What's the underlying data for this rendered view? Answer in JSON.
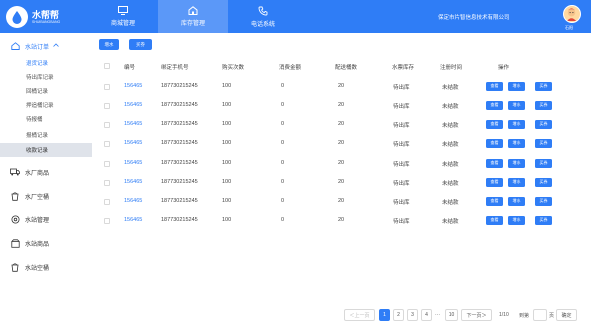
{
  "header": {
    "logo_name": "水帮帮",
    "logo_sub": "SHUIBANGBANG",
    "tabs": [
      {
        "label": "商城管理"
      },
      {
        "label": "库存管理"
      },
      {
        "label": "电话系统"
      }
    ],
    "company": "保定市片智信息技术有限公司",
    "username": "石阳"
  },
  "sidebar": {
    "groups": [
      {
        "label": "水站订单",
        "icon": "home-icon"
      },
      {
        "label": "水厂商品",
        "icon": "truck-icon"
      },
      {
        "label": "水厂空桶",
        "icon": "bucket-icon"
      },
      {
        "label": "水站管理",
        "icon": "gear-icon"
      },
      {
        "label": "水站商品",
        "icon": "box-icon"
      },
      {
        "label": "水站空桶",
        "icon": "bucket-icon"
      }
    ],
    "subitems": [
      {
        "label": "退货记录"
      },
      {
        "label": "待出库记录"
      },
      {
        "label": "回桶记录"
      },
      {
        "label": "押追桶记录"
      },
      {
        "label": "待报桶"
      },
      {
        "label": "报桶记录"
      },
      {
        "label": "收款记录"
      }
    ]
  },
  "toolbar": {
    "btn1": "增水",
    "btn2": "买券"
  },
  "table": {
    "headers": [
      "编号",
      "绑定手机号",
      "购买次数",
      "消费金额",
      "配送桶数",
      "水票库存",
      "注册时间",
      "操作"
    ],
    "rows": [
      {
        "id": "156465",
        "phone": "187730215245",
        "count": "100",
        "amount": "0",
        "buckets": "20",
        "stock": "待出库",
        "reg": "未结款"
      },
      {
        "id": "156465",
        "phone": "187730215245",
        "count": "100",
        "amount": "0",
        "buckets": "20",
        "stock": "待出库",
        "reg": "未结款"
      },
      {
        "id": "156465",
        "phone": "187730215245",
        "count": "100",
        "amount": "0",
        "buckets": "20",
        "stock": "待出库",
        "reg": "未结款"
      },
      {
        "id": "156465",
        "phone": "187730215245",
        "count": "100",
        "amount": "0",
        "buckets": "20",
        "stock": "待出库",
        "reg": "未结款"
      },
      {
        "id": "156465",
        "phone": "187730215245",
        "count": "100",
        "amount": "0",
        "buckets": "20",
        "stock": "待出库",
        "reg": "未结款"
      },
      {
        "id": "156465",
        "phone": "187730215245",
        "count": "100",
        "amount": "0",
        "buckets": "20",
        "stock": "待出库",
        "reg": "未结款"
      },
      {
        "id": "156465",
        "phone": "187730215245",
        "count": "100",
        "amount": "0",
        "buckets": "20",
        "stock": "待出库",
        "reg": "未结款"
      },
      {
        "id": "156465",
        "phone": "187730215245",
        "count": "100",
        "amount": "0",
        "buckets": "20",
        "stock": "待出库",
        "reg": "未结款"
      }
    ],
    "actions": [
      "查看",
      "增水",
      "买券"
    ]
  },
  "pagination": {
    "prev": "＜上一页",
    "pages": [
      "1",
      "2",
      "3",
      "4"
    ],
    "ellipsis": "···",
    "last": "10",
    "next": "下一页＞",
    "total": "1/10",
    "goto": "到第",
    "page_unit": "页",
    "confirm": "确定"
  },
  "colors": {
    "accent": "#2f7df6"
  }
}
